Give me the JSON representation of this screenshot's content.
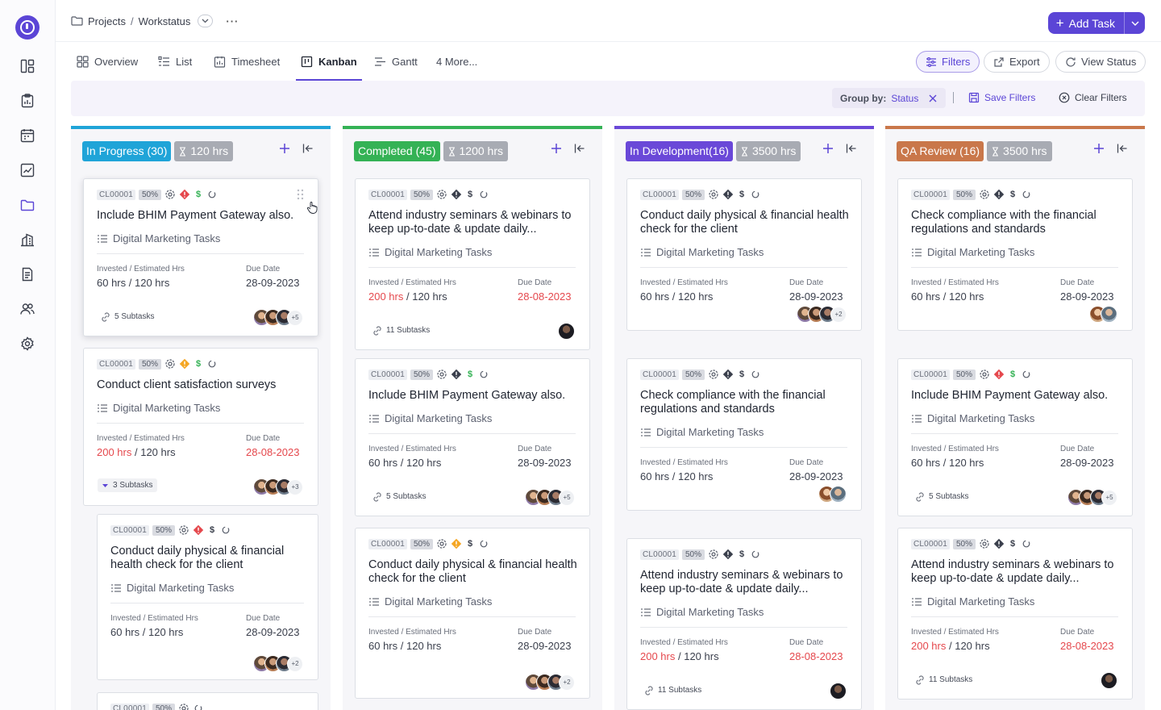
{
  "breadcrumb": {
    "root": "Projects",
    "separator": "/",
    "current": "Workstatus"
  },
  "header": {
    "add_task_label": "Add Task"
  },
  "tabs": [
    {
      "label": "Overview",
      "icon": "overview-grid-icon"
    },
    {
      "label": "List",
      "icon": "list-icon"
    },
    {
      "label": "Timesheet",
      "icon": "timesheet-icon"
    },
    {
      "label": "Kanban",
      "icon": "kanban-icon",
      "active": true
    },
    {
      "label": "Gantt",
      "icon": "gantt-icon"
    },
    {
      "label": "4 More..."
    }
  ],
  "toolbar": {
    "filters_label": "Filters",
    "export_label": "Export",
    "view_status_label": "View Status"
  },
  "filterbar": {
    "group_by_label": "Group by:",
    "group_by_value": "Status",
    "divider": "|",
    "save_filters_label": "Save Filters",
    "clear_filters_label": "Clear Filters"
  },
  "colors": {
    "accent": "#5b45d6",
    "in_progress": "#1fa4d8",
    "completed": "#34b255",
    "in_development": "#6a48d8",
    "qa_review": "#c9774a",
    "danger": "#e5484d",
    "warning": "#f5a623"
  },
  "columns": [
    {
      "title": "In Progress (30)",
      "hours": "120 hrs",
      "color": "#1fa4d8",
      "cards": [
        {
          "code": "CL00001",
          "pct": "50%",
          "flag": "red",
          "dollar": "green",
          "title": "Include BHIM Payment Gateway also.",
          "list": "Digital Marketing Tasks",
          "inv_label": "Invested / Estimated Hrs",
          "invested": "60 hrs",
          "slash": " / ",
          "estimated": "120 hrs",
          "due_label": "Due Date",
          "due": "28-09-2023",
          "overdue": false,
          "subtasks": "5 Subtasks",
          "more": "+5"
        },
        {
          "code": "CL00001",
          "pct": "50%",
          "flag": "yellow",
          "dollar": "green",
          "title": "Conduct client satisfaction surveys",
          "list": "Digital Marketing Tasks",
          "inv_label": "Invested / Estimated Hrs",
          "invested": "200 hrs",
          "slash": " / ",
          "estimated": "120 hrs",
          "due_label": "Due Date",
          "due": "28-08-2023",
          "overdue": true,
          "subtasks": "3 Subtasks",
          "more": "+3"
        },
        {
          "code": "CL00001",
          "pct": "50%",
          "flag": "red",
          "dollar": "dark",
          "title": "Conduct daily physical & financial health check for the client",
          "list": "Digital Marketing Tasks",
          "inv_label": "Invested / Estimated Hrs",
          "invested": "60 hrs",
          "slash": " / ",
          "estimated": "120 hrs",
          "due_label": "Due Date",
          "due": "28-09-2023",
          "overdue": false,
          "more": "+2"
        },
        {
          "code": "CL00001",
          "pct": "50%"
        }
      ]
    },
    {
      "title": "Completed (45)",
      "hours": "1200 hrs",
      "color": "#34b255",
      "cards": [
        {
          "code": "CL00001",
          "pct": "50%",
          "flag": "dark",
          "dollar": "dark",
          "title": "Attend industry seminars & webinars to keep up-to-date & update daily...",
          "list": "Digital Marketing Tasks",
          "inv_label": "Invested / Estimated Hrs",
          "invested": "200 hrs",
          "slash": " / ",
          "estimated": "120 hrs",
          "due_label": "Due Date",
          "due": "28-08-2023",
          "overdue": true,
          "subtasks": "11 Subtasks"
        },
        {
          "code": "CL00001",
          "pct": "50%",
          "flag": "dark",
          "dollar": "green",
          "title": "Include BHIM Payment Gateway also.",
          "list": "Digital Marketing Tasks",
          "inv_label": "Invested / Estimated Hrs",
          "invested": "60 hrs",
          "slash": " / ",
          "estimated": "120 hrs",
          "due_label": "Due Date",
          "due": "28-09-2023",
          "overdue": false,
          "subtasks": "5 Subtasks",
          "more": "+5"
        },
        {
          "code": "CL00001",
          "pct": "50%",
          "flag": "yellow",
          "dollar": "dark",
          "title": "Conduct daily physical & financial health check for the client",
          "list": "Digital Marketing Tasks",
          "inv_label": "Invested / Estimated Hrs",
          "invested": "60 hrs",
          "slash": " / ",
          "estimated": "120 hrs",
          "due_label": "Due Date",
          "due": "28-09-2023",
          "overdue": false,
          "more": "+2"
        }
      ]
    },
    {
      "title": "In Development(16)",
      "hours": "3500 hrs",
      "color": "#6a48d8",
      "cards": [
        {
          "code": "CL00001",
          "pct": "50%",
          "flag": "dark",
          "dollar": "dark",
          "title": "Conduct daily physical & financial health check for the client",
          "list": "Digital Marketing Tasks",
          "inv_label": "Invested / Estimated Hrs",
          "invested": "60 hrs",
          "slash": " / ",
          "estimated": "120 hrs",
          "due_label": "Due Date",
          "due": "28-09-2023",
          "overdue": false,
          "more": "+2"
        },
        {
          "code": "CL00001",
          "pct": "50%",
          "flag": "dark",
          "dollar": "dark",
          "title": "Check compliance with the financial regulations and standards",
          "list": "Digital Marketing Tasks",
          "inv_label": "Invested / Estimated Hrs",
          "invested": "60 hrs",
          "slash": " / ",
          "estimated": "120 hrs",
          "due_label": "Due Date",
          "due": "28-09-2023",
          "overdue": false
        },
        {
          "code": "CL00001",
          "pct": "50%",
          "flag": "dark",
          "dollar": "dark",
          "title": "Attend industry seminars & webinars to keep up-to-date & update daily...",
          "list": "Digital Marketing Tasks",
          "inv_label": "Invested / Estimated Hrs",
          "invested": "200 hrs",
          "slash": " / ",
          "estimated": "120 hrs",
          "due_label": "Due Date",
          "due": "28-08-2023",
          "overdue": true,
          "subtasks": "11 Subtasks"
        }
      ]
    },
    {
      "title": "QA Review (16)",
      "hours": "3500 hrs",
      "color": "#c9774a",
      "cards": [
        {
          "code": "CL00001",
          "pct": "50%",
          "flag": "dark",
          "dollar": "dark",
          "title": "Check compliance with the financial regulations and standards",
          "list": "Digital Marketing Tasks",
          "inv_label": "Invested / Estimated Hrs",
          "invested": "60 hrs",
          "slash": " / ",
          "estimated": "120 hrs",
          "due_label": "Due Date",
          "due": "28-09-2023",
          "overdue": false
        },
        {
          "code": "CL00001",
          "pct": "50%",
          "flag": "red",
          "dollar": "green",
          "title": "Include BHIM Payment Gateway also.",
          "list": "Digital Marketing Tasks",
          "inv_label": "Invested / Estimated Hrs",
          "invested": "60 hrs",
          "slash": " / ",
          "estimated": "120 hrs",
          "due_label": "Due Date",
          "due": "28-09-2023",
          "overdue": false,
          "subtasks": "5 Subtasks",
          "more": "+5"
        },
        {
          "code": "CL00001",
          "pct": "50%",
          "flag": "dark",
          "dollar": "dark",
          "title": "Attend industry seminars & webinars to keep up-to-date & update daily...",
          "list": "Digital Marketing Tasks",
          "inv_label": "Invested / Estimated Hrs",
          "invested": "200 hrs",
          "slash": " / ",
          "estimated": "120 hrs",
          "due_label": "Due Date",
          "due": "28-08-2023",
          "overdue": true,
          "subtasks": "11 Subtasks"
        }
      ]
    }
  ]
}
